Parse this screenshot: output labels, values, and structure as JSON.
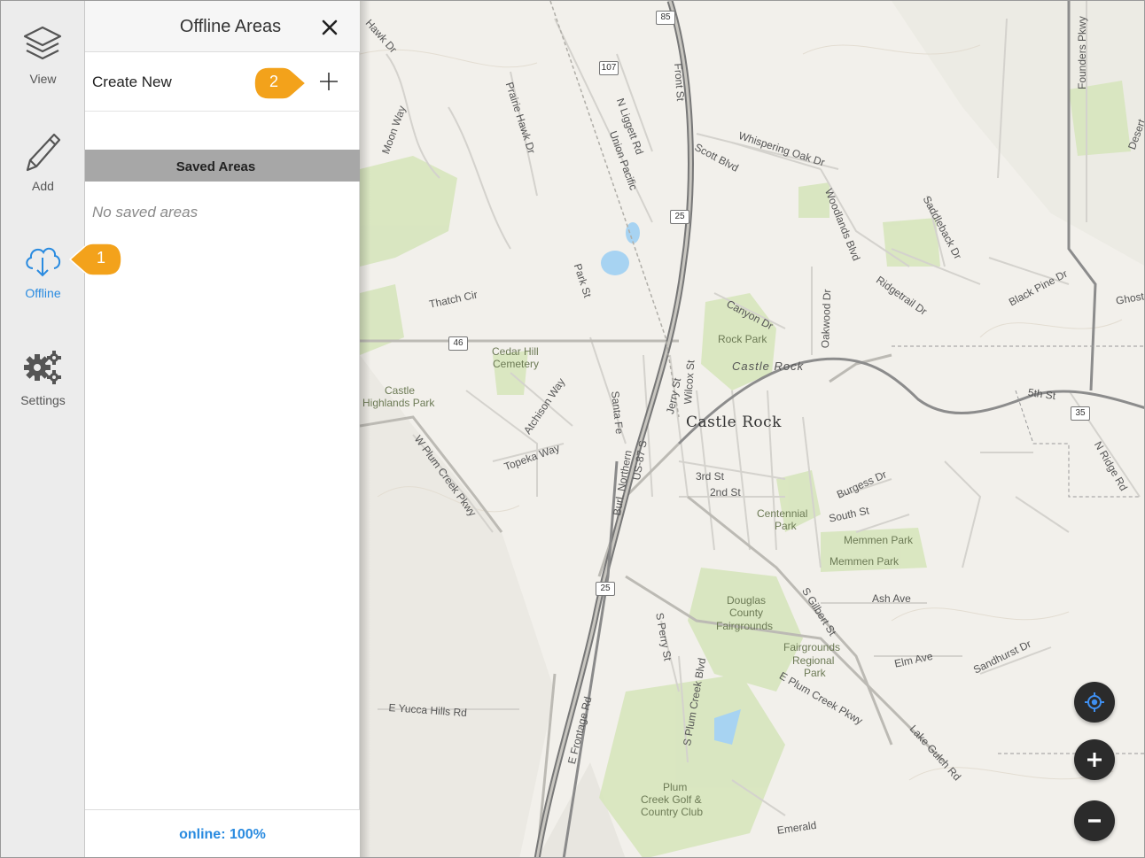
{
  "rail": {
    "items": [
      {
        "label": "View",
        "icon": "layers-icon"
      },
      {
        "label": "Add",
        "icon": "pencil-icon"
      },
      {
        "label": "Offline",
        "icon": "cloud-download-icon",
        "active": true
      },
      {
        "label": "Settings",
        "icon": "gears-icon"
      }
    ]
  },
  "panel": {
    "title": "Offline Areas",
    "create_label": "Create New",
    "saved_header": "Saved Areas",
    "empty_message": "No saved areas",
    "footer_status": "online: 100%"
  },
  "callouts": [
    {
      "number": "1"
    },
    {
      "number": "2"
    }
  ],
  "map": {
    "labels": {
      "castle_rock": "Castle Rock",
      "castle_rock_feature": "Castle Rock",
      "rock_park": "Rock Park",
      "canyon_dr": "Canyon Dr",
      "cedar_hill": "Cedar Hill",
      "cemetery": "Cemetery",
      "castle_highlands": "Castle",
      "castle_highlands2": "Highlands Park",
      "centennial": "Centennial",
      "centennial2": "Park",
      "memmen1": "Memmen Park",
      "memmen2": "Memmen Park",
      "douglas1": "Douglas",
      "douglas2": "County",
      "douglas3": "Fairgrounds",
      "fair1": "Fairgrounds",
      "fair2": "Regional",
      "fair3": "Park",
      "plum1": "Plum",
      "plum2": "Creek Golf &",
      "plum3": "Country Club",
      "third": "3rd St",
      "second": "2nd St",
      "south": "South St",
      "ash": "Ash Ave",
      "elm": "Elm Ave",
      "fifth": "5th St",
      "yucca": "E Yucca Hills Rd",
      "thatch": "Thatch Cir",
      "front": "Front St",
      "scott": "Scott Blvd",
      "whispering": "Whispering Oak Dr",
      "woodlands": "Woodlands Blvd",
      "saddleback": "Saddleback Dr",
      "ridgetrail": "Ridgetrail Dr",
      "blackpine": "Black Pine Dr",
      "oakwood": "Oakwood Dr",
      "prairie": "Prairie Hawk Dr",
      "nliggett": "N Liggett Rd",
      "union": "Union Pacific",
      "park": "Park St",
      "wilcox": "Wilcox St",
      "jerry": "Jerry St",
      "santafe": "Santa Fe",
      "atchison": "Atchison Way",
      "topeka": "Topeka Way",
      "wplum": "W Plum Creek Pkwy",
      "us87": "US-87 S",
      "burlnorth": "Burl. Northern",
      "sperry": "S Perry St",
      "splum": "S Plum Creek Blvd",
      "eplum": "E Plum Creek Pkwy",
      "sgilbert": "S Gilbert St",
      "frontage": "E Frontage Rd",
      "burgess": "Burgess Dr",
      "sandhurst": "Sandhurst Dr",
      "lakegulch": "Lake Gulch Rd",
      "nridge": "N Ridge Rd",
      "founders": "Founders Pkwy",
      "emerald": "Emerald",
      "hawk": "Hawk Dr",
      "moonway": "Moon Way",
      "ghost": "Ghost",
      "desert": "Desert"
    },
    "shields": {
      "s85": "85",
      "s107": "107",
      "s25a": "25",
      "s46": "46",
      "s25b": "25",
      "s35": "35"
    }
  },
  "map_controls": {
    "locate_icon": "locate-icon",
    "zoom_in_icon": "zoom-in-icon",
    "zoom_out_icon": "zoom-out-icon"
  },
  "colors": {
    "accent": "#2a8be0",
    "callout": "#f3a21b",
    "park_green": "#d7e5bd"
  }
}
